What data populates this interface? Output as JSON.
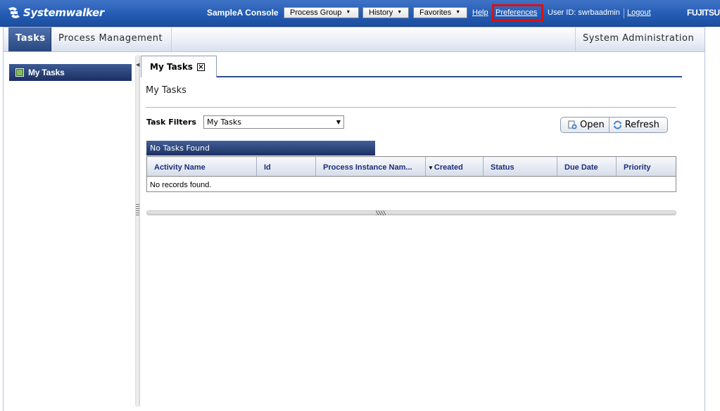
{
  "header": {
    "product": "Systemwalker",
    "console_name": "SampleA Console",
    "dropdowns": [
      "Process Group",
      "History",
      "Favorites"
    ],
    "help_link": "Help",
    "preferences_link": "Preferences",
    "user_id": "User ID: swrbaadmin",
    "logout_link": "Logout",
    "brand": "FUJITSU",
    "highlight_color": "#e01010"
  },
  "nav": {
    "tabs": [
      "Tasks",
      "Process Management"
    ],
    "right_tab": "System Administration",
    "active": "Tasks"
  },
  "sidebar": {
    "items": [
      {
        "label": "My Tasks"
      }
    ]
  },
  "content": {
    "tab_label": "My Tasks",
    "page_title": "My Tasks",
    "filter_label": "Task Filters",
    "filter_value": "My Tasks",
    "open_button": "Open",
    "refresh_button": "Refresh",
    "status": "No Tasks Found",
    "columns": [
      "Activity Name",
      "Id",
      "Process Instance Nam...",
      "Created",
      "Status",
      "Due Date",
      "Priority"
    ],
    "sorted_column": "Created",
    "empty_message": "No records found."
  }
}
